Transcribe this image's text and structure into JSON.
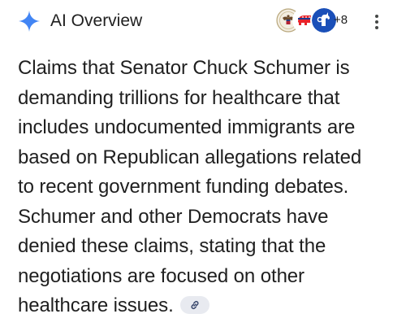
{
  "header": {
    "title": "AI Overview",
    "icon": "gemini-sparkle-icon",
    "sparkle_color": "#4285f4",
    "sources": [
      {
        "icon": "us-seal-icon"
      },
      {
        "icon": "republican-elephant-icon",
        "color": "#e8232a"
      },
      {
        "icon": "democrat-donkey-icon",
        "color": "#1a4fb8"
      }
    ],
    "more_sources_label": "+8",
    "menu_icon": "more-vert-icon"
  },
  "overview": {
    "lines": [
      "Claims that Senator Chuck Schumer is",
      "demanding trillions for healthcare that",
      "includes undocumented immigrants are",
      "based on Republican allegations related",
      "to recent government funding debates.",
      "Schumer and other Democrats have",
      "denied these claims, stating that the",
      "negotiations are focused on other",
      "healthcare issues."
    ],
    "link_icon": "link-icon",
    "chip_color": "#e8eaf0"
  }
}
